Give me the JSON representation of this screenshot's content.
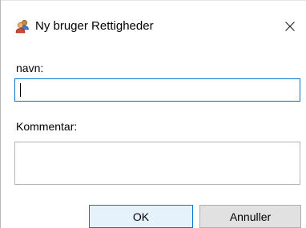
{
  "window": {
    "title": "Ny bruger Rettigheder",
    "icon": "users-icon",
    "close_glyph": "×"
  },
  "form": {
    "name_label": "navn:",
    "name_value": "",
    "comment_label": "Kommentar:",
    "comment_value": ""
  },
  "buttons": {
    "ok_label": "OK",
    "cancel_label": "Annuller"
  },
  "colors": {
    "focus_border": "#0a74d1",
    "default_button_border": "#0078d7",
    "default_button_bg": "#e5f1fb",
    "button_bg": "#e1e1e1"
  }
}
